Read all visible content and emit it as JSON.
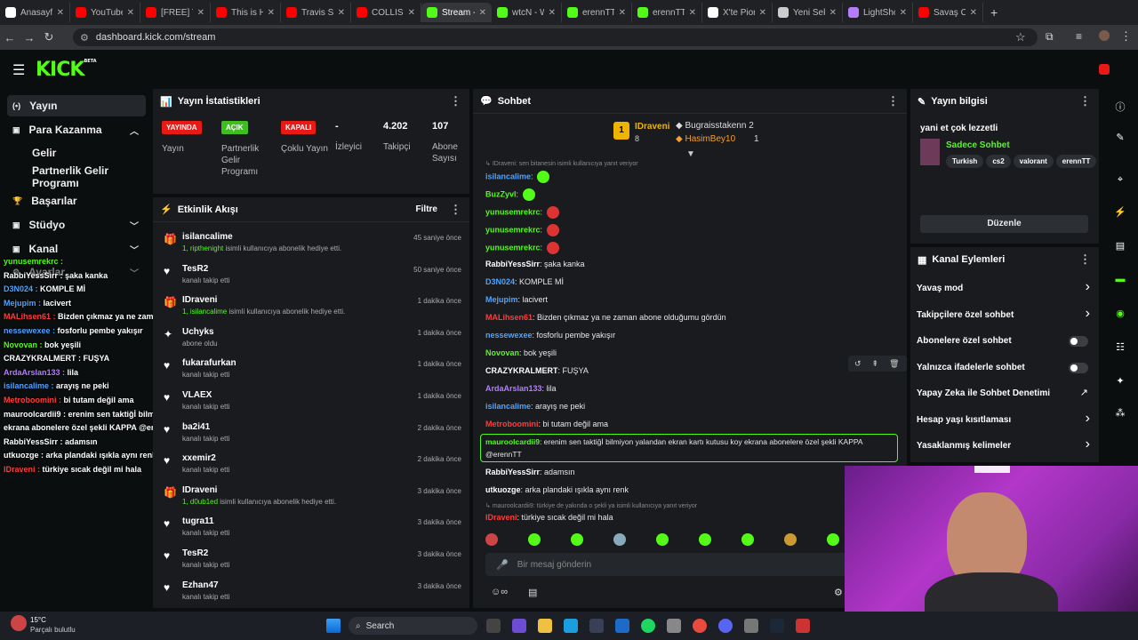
{
  "browser": {
    "tabs": [
      {
        "label": "Anasayfa",
        "color": "#ffffff",
        "active": false
      },
      {
        "label": "YouTube",
        "color": "#ff0000",
        "active": false
      },
      {
        "label": "[FREE] Ti",
        "color": "#ff0000",
        "active": false
      },
      {
        "label": "This is H",
        "color": "#ff0000",
        "active": false
      },
      {
        "label": "Travis Sc",
        "color": "#ff0000",
        "active": false
      },
      {
        "label": "COLLISIC",
        "color": "#ff0000",
        "active": false
      },
      {
        "label": "Stream -",
        "color": "#53fc18",
        "active": true
      },
      {
        "label": "wtcN - W",
        "color": "#53fc18",
        "active": false
      },
      {
        "label": "erennTT",
        "color": "#53fc18",
        "active": false
      },
      {
        "label": "erennTT",
        "color": "#53fc18",
        "active": false
      },
      {
        "label": "X'te Pior",
        "color": "#ffffff",
        "active": false
      },
      {
        "label": "Yeni Sek",
        "color": "#cccccc",
        "active": false
      },
      {
        "label": "LightSho",
        "color": "#b57cff",
        "active": false
      },
      {
        "label": "Savaş Ce",
        "color": "#ff0000",
        "active": false
      }
    ],
    "url": "dashboard.kick.com/stream"
  },
  "logo": "KICK",
  "logo_sup": "BETA",
  "sidebar": {
    "items": [
      {
        "label": "Yayın",
        "icon": "(•)"
      },
      {
        "label": "Para Kazanma",
        "icon": "▣"
      },
      {
        "label": "Gelir",
        "icon": ""
      },
      {
        "label": "Partnerlik Gelir Programı",
        "icon": ""
      },
      {
        "label": "Başarılar",
        "icon": "🏆"
      },
      {
        "label": "Stüdyo",
        "icon": "▣"
      },
      {
        "label": "Kanal",
        "icon": "▣"
      },
      {
        "label": "Ayarlar",
        "icon": "⚙"
      }
    ]
  },
  "overlay_chat": [
    {
      "user": "yunusemrekrc :",
      "msg": "",
      "color": "#53fc18"
    },
    {
      "user": "RabbiYessSirr :",
      "msg": " şaka kanka",
      "color": "#ffffff"
    },
    {
      "user": "D3N024 :",
      "msg": " KOMPLE Mİ",
      "color": "#4fa3ff"
    },
    {
      "user": "Mejupim :",
      "msg": " lacivert",
      "color": "#4fa3ff"
    },
    {
      "user": "MALihsen61 :",
      "msg": " Bizden çıkmaz ya ne zaman abone olduğumu gördün",
      "color": "#ff3c3c"
    },
    {
      "user": "nessewexee :",
      "msg": " fosforlu pembe yakışır",
      "color": "#4fa3ff"
    },
    {
      "user": "Novovan :",
      "msg": " bok yeşili",
      "color": "#53fc18"
    },
    {
      "user": "CRAZYKRALMERT :",
      "msg": " FUŞYA",
      "color": "#ffffff"
    },
    {
      "user": "ArdaArslan133 :",
      "msg": " lila",
      "color": "#b57cff"
    },
    {
      "user": "isilancalime :",
      "msg": " arayış ne peki",
      "color": "#4fa3ff"
    },
    {
      "user": "Metroboomini :",
      "msg": " bi tutam değil ama",
      "color": "#ff3c3c"
    },
    {
      "user": "mauroolcardii9 :",
      "msg": " erenim sen taktiğİ bilmiyon yalandan ekran kartı kutusu koy",
      "color": "#ffffff"
    },
    {
      "user": "",
      "msg": "ekrana abonelere özel şekli KAPPA @erennTT",
      "color": "#ffffff"
    },
    {
      "user": "RabbiYessSirr :",
      "msg": " adamsın",
      "color": "#ffffff"
    },
    {
      "user": "utkuozge :",
      "msg": " arka plandaki ışıkla aynı renk",
      "color": "#ffffff"
    },
    {
      "user": "IDraveni :",
      "msg": " türkiye sıcak değil mi hala",
      "color": "#ff3c3c"
    }
  ],
  "stats": {
    "title": "Yayın İstatistikleri",
    "items": [
      {
        "badge": "YAYINDA",
        "badge_color": "#e91916",
        "label": "Yayın"
      },
      {
        "badge": "AÇIK",
        "badge_color": "#3fbf1f",
        "label": "Partnerlik Gelir Programı"
      },
      {
        "badge": "KAPALI",
        "badge_color": "#e91916",
        "label": "Çoklu Yayın"
      },
      {
        "value": "-",
        "label": "İzleyici"
      },
      {
        "value": "4.202",
        "label": "Takipçi"
      },
      {
        "value": "107",
        "label": "Abone Sayısı"
      }
    ]
  },
  "activity": {
    "title": "Etkinlik Akışı",
    "filter": "Filtre",
    "events": [
      {
        "icon": "gift",
        "name": "isilancalime",
        "hl": "1, ripthenight",
        "desc": " isimli kullanıcıya abonelik hediye etti.",
        "time": "45 saniye önce"
      },
      {
        "icon": "heart",
        "name": "TesR2",
        "hl": "",
        "desc": "kanalı takip etti",
        "time": "50 saniye önce"
      },
      {
        "icon": "gift",
        "name": "IDraveni",
        "hl": "1, isilancalime",
        "desc": " isimli kullanıcıya abonelik hediye etti.",
        "time": "1 dakika önce"
      },
      {
        "icon": "star",
        "name": "Uchyks",
        "hl": "",
        "desc": "abone oldu",
        "time": "1 dakika önce"
      },
      {
        "icon": "heart",
        "name": "fukarafurkan",
        "hl": "",
        "desc": "kanalı takip etti",
        "time": "1 dakika önce"
      },
      {
        "icon": "heart",
        "name": "VLAEX",
        "hl": "",
        "desc": "kanalı takip etti",
        "time": "1 dakika önce"
      },
      {
        "icon": "heart",
        "name": "ba2i41",
        "hl": "",
        "desc": "kanalı takip etti",
        "time": "2 dakika önce"
      },
      {
        "icon": "heart",
        "name": "xxemir2",
        "hl": "",
        "desc": "kanalı takip etti",
        "time": "2 dakika önce"
      },
      {
        "icon": "gift",
        "name": "IDraveni",
        "hl": "1, d0ub1ed",
        "desc": " isimli kullanıcıya abonelik hediye etti.",
        "time": "3 dakika önce"
      },
      {
        "icon": "heart",
        "name": "tugra11",
        "hl": "",
        "desc": "kanalı takip etti",
        "time": "3 dakika önce"
      },
      {
        "icon": "heart",
        "name": "TesR2",
        "hl": "",
        "desc": "kanalı takip etti",
        "time": "3 dakika önce"
      },
      {
        "icon": "heart",
        "name": "Ezhan47",
        "hl": "",
        "desc": "kanalı takip etti",
        "time": "3 dakika önce"
      }
    ]
  },
  "chat": {
    "title": "Sohbet",
    "leaders": [
      {
        "name": "IDraveni",
        "count": "8"
      },
      {
        "name": "Bugraisstakenn",
        "count": "2"
      },
      {
        "name": "HasimBey10",
        "count": "1"
      }
    ],
    "reply_hint_1": "IDraveni: sen bitanesin isimli kullanıcıya yanıt veriyor",
    "reply_hint_2": "mauroolcardii9: türkiye de yakında o şekli ya isimli kullanıcıya yanıt veriyor",
    "messages": [
      {
        "user": "isilancalime",
        "color": "#4fa3ff",
        "msg": ": "
      },
      {
        "user": "BuzZyvl",
        "color": "#53fc18",
        "msg": ": "
      },
      {
        "user": "yunusemrekrc",
        "color": "#53fc18",
        "msg": ": "
      },
      {
        "user": "yunusemrekrc",
        "color": "#53fc18",
        "msg": ": "
      },
      {
        "user": "yunusemrekrc",
        "color": "#53fc18",
        "msg": ": "
      },
      {
        "user": "RabbiYessSirr",
        "color": "#ffffff",
        "msg": ": şaka kanka"
      },
      {
        "user": "D3N024",
        "color": "#4fa3ff",
        "msg": ": KOMPLE Mİ"
      },
      {
        "user": "Mejupim",
        "color": "#4fa3ff",
        "msg": ": lacivert"
      },
      {
        "user": "MALihsen61",
        "color": "#ff3c3c",
        "msg": ": Bizden çıkmaz ya ne zaman abone olduğumu gördün"
      },
      {
        "user": "nessewexee",
        "color": "#4fa3ff",
        "msg": ": fosforlu pembe yakışır"
      },
      {
        "user": "Novovan",
        "color": "#53fc18",
        "msg": ": bok yeşili"
      },
      {
        "user": "CRAZYKRALMERT",
        "color": "#ffffff",
        "msg": ": FUŞYA"
      },
      {
        "user": "ArdaArslan133",
        "color": "#b57cff",
        "msg": ": lila"
      },
      {
        "user": "isilancalime",
        "color": "#4fa3ff",
        "msg": ": arayış ne peki"
      },
      {
        "user": "Metroboomini",
        "color": "#ff3c3c",
        "msg": ": bi tutam değil ama"
      },
      {
        "user": "mauroolcardii9",
        "color": "#53fc18",
        "msg": ": erenim sen taktiğİ bilmiyon yalandan ekran kartı kutusu koy ekrana abonelere özel şekli KAPPA"
      },
      {
        "user": "",
        "color": "#ffffff",
        "msg": "@erennTT"
      },
      {
        "user": "RabbiYessSirr",
        "color": "#ffffff",
        "msg": ": adamsın"
      },
      {
        "user": "utkuozge",
        "color": "#ffffff",
        "msg": ": arka plandaki ışıkla aynı renk"
      },
      {
        "user": "IDraveni",
        "color": "#ff3c3c",
        "msg": ": türkiye sıcak değil mi hala"
      }
    ],
    "placeholder": "Bir mesaj gönderin"
  },
  "stream_info": {
    "title": "Yayın bilgisi",
    "stream_title": "yani et çok lezzetli",
    "category": "Sadece Sohbet",
    "tags": [
      "Turkish",
      "cs2",
      "valorant",
      "erennTT"
    ],
    "edit": "Düzenle"
  },
  "channel_actions": {
    "title": "Kanal Eylemleri",
    "items": [
      {
        "label": "Yavaş mod",
        "kind": "arrow"
      },
      {
        "label": "Takipçilere özel sohbet",
        "kind": "arrow"
      },
      {
        "label": "Abonelere özel sohbet",
        "kind": "toggle"
      },
      {
        "label": "Yalnızca ifadelerle sohbet",
        "kind": "toggle"
      },
      {
        "label": "Yapay Zeka ile Sohbet Denetimi",
        "kind": "ext"
      },
      {
        "label": "Hesap yaşı kısıtlaması",
        "kind": "arrow"
      },
      {
        "label": "Yasaklanmış kelimeler",
        "kind": "arrow"
      }
    ]
  },
  "taskbar": {
    "weather_temp": "15°C",
    "weather_desc": "Parçalı bulutlu",
    "search": "Search"
  },
  "colors": {
    "accent": "#53fc18",
    "panel": "#191b1f",
    "bg": "#0b0e0f"
  }
}
